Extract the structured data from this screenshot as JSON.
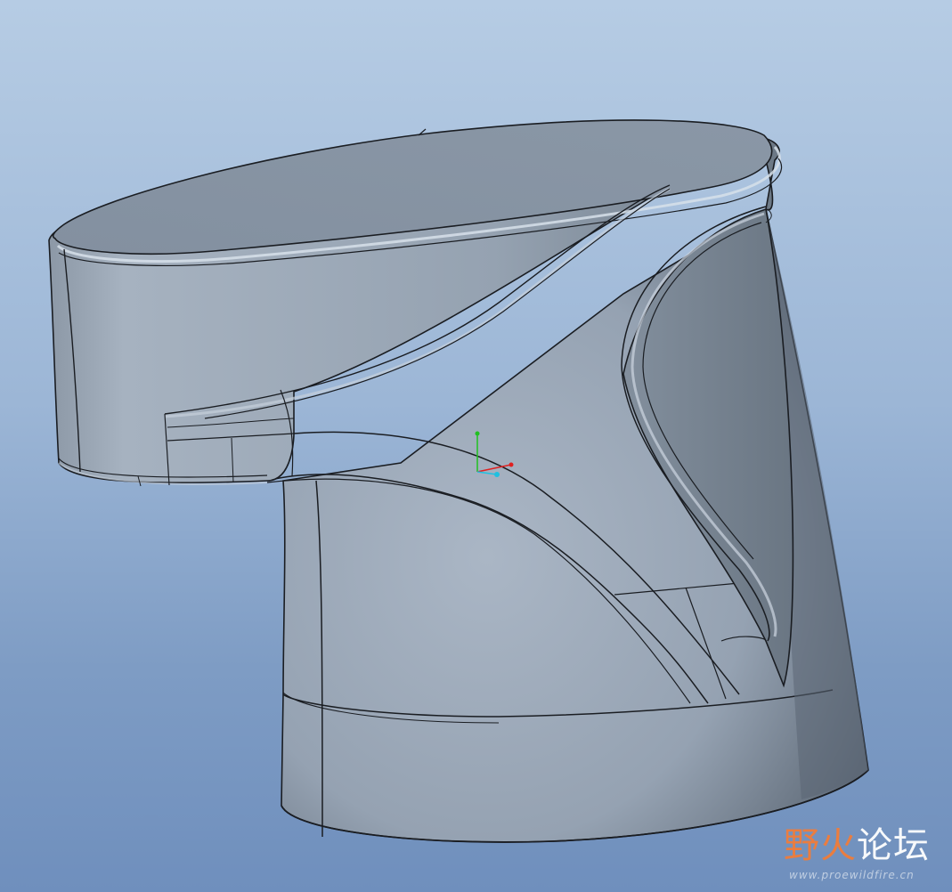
{
  "viewport": {
    "background_top": "#b6cce4",
    "background_bottom": "#6f8fbd",
    "model_color": "#9eabba",
    "edge_color": "#1a1d22"
  },
  "triad": {
    "icon": "coordinate-axes-icon",
    "colors": {
      "x": "#e02020",
      "y": "#20c020",
      "z": "#20c0e0"
    }
  },
  "watermark": {
    "brand_part1": "野火",
    "brand_part2": "论坛",
    "url": "www.proewildfire.cn",
    "accent_color": "#ff7a2a"
  }
}
